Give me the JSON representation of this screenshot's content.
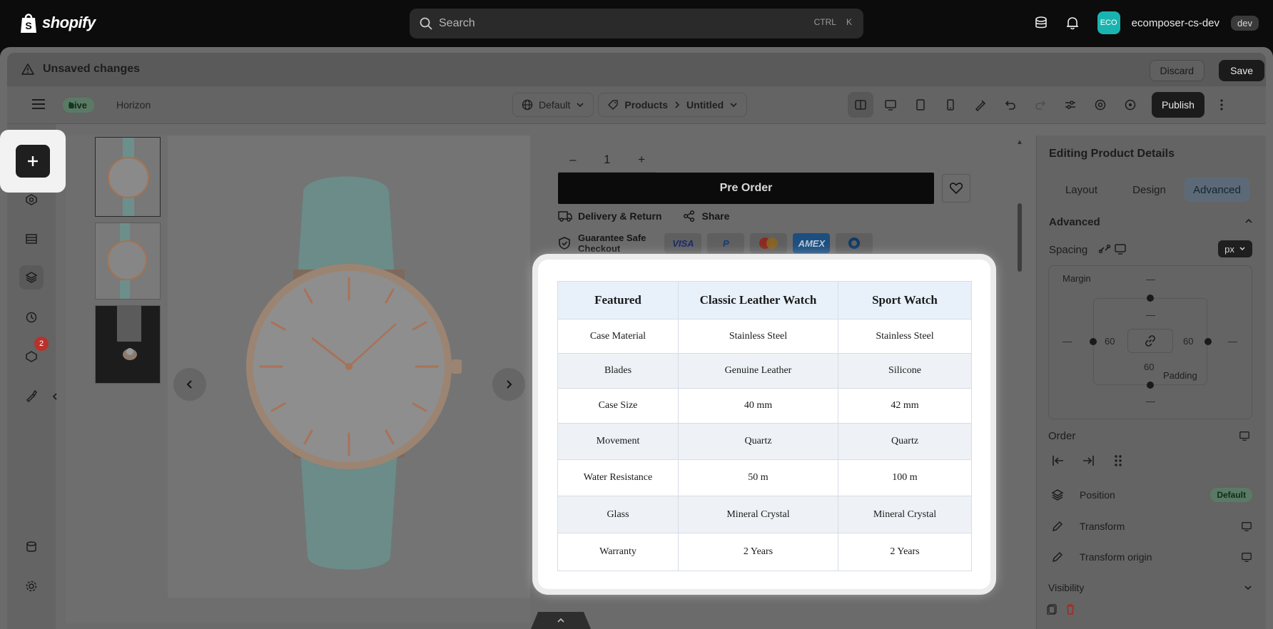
{
  "topbar": {
    "brand": "shopify",
    "search_placeholder": "Search",
    "shortcut_ctrl": "CTRL",
    "shortcut_key": "K",
    "store_avatar": "ECO",
    "store_name": "ecomposer-cs-dev",
    "store_badge": "dev"
  },
  "unsaved": {
    "message": "Unsaved changes",
    "discard_label": "Discard",
    "save_label": "Save"
  },
  "toolbar": {
    "status": "Live",
    "theme": "Horizon",
    "template": "Default",
    "breadcrumb_parent": "Products",
    "breadcrumb_current": "Untitled",
    "publish_label": "Publish"
  },
  "sidebar": {
    "notification_count": "2"
  },
  "product": {
    "quantity": "1",
    "qty_minus": "–",
    "qty_plus": "+",
    "preorder_label": "Pre Order",
    "delivery_label": "Delivery & Return",
    "share_label": "Share",
    "guarantee_line1": "Guarantee Safe",
    "guarantee_line2": "Checkout",
    "payment_methods": [
      "VISA",
      "P",
      "mastercard",
      "AMEX",
      "diners"
    ]
  },
  "spec_table": {
    "headers": [
      "Featured",
      "Classic Leather Watch",
      "Sport Watch"
    ],
    "rows": [
      [
        "Case Material",
        "Stainless Steel",
        "Stainless Steel"
      ],
      [
        "Blades",
        "Genuine Leather",
        "Silicone"
      ],
      [
        "Case Size",
        "40 mm",
        "42 mm"
      ],
      [
        "Movement",
        "Quartz",
        "Quartz"
      ],
      [
        "Water Resistance",
        "50 m",
        "100 m"
      ],
      [
        "Glass",
        "Mineral Crystal",
        "Mineral Crystal"
      ],
      [
        "Warranty",
        "2 Years",
        "2 Years"
      ]
    ]
  },
  "panel": {
    "title": "Editing Product Details",
    "tabs": [
      "Layout",
      "Design",
      "Advanced"
    ],
    "active_tab": "Advanced",
    "section_advanced": "Advanced",
    "spacing_label": "Spacing",
    "unit": "px",
    "margin_label": "Margin",
    "padding_label": "Padding",
    "margin_top": "—",
    "margin_bottom": "—",
    "margin_left": "—",
    "margin_right": "—",
    "padding_top": "—",
    "padding_left": "60",
    "padding_right": "60",
    "padding_bottom": "60",
    "order_label": "Order",
    "position_label": "Position",
    "position_value": "Default",
    "transform_label": "Transform",
    "transform_origin_label": "Transform origin",
    "visibility_label": "Visibility"
  },
  "colors": {
    "overlay": "#6b6b6b",
    "highlight": "#ffffff",
    "table_header_bg": "#e8f1fa",
    "table_alt_bg": "#eef2f6",
    "preorder_bg": "#0b0b0b",
    "active_tab_bg": "#5c6a78"
  }
}
